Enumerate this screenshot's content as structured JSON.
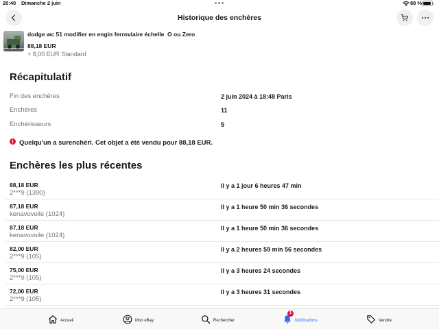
{
  "status_bar": {
    "time": "20:40",
    "date": "Dimanche 2 juin",
    "battery_text": "88 %",
    "battery_level": 0.88
  },
  "header": {
    "title": "Historique des enchères",
    "icons": [
      "chevron-left-icon",
      "cart-icon",
      "more-options-icon"
    ]
  },
  "item": {
    "title": "dodge wc 51 modifier en engin ferroviaire échelle  O ou Zero",
    "price": "88,18 EUR",
    "shipping": "+ 8,00 EUR Standard"
  },
  "summary": {
    "heading": "Récapitulatif",
    "rows": [
      {
        "label": "Fin des enchères",
        "value": "2 juin 2024 à 18:48 Paris"
      },
      {
        "label": "Enchères",
        "value": "11"
      },
      {
        "label": "Enchérisseurs",
        "value": "5"
      }
    ]
  },
  "alert": {
    "icon": "alert-icon",
    "text": "Quelqu'un a surenchéri. Cet objet a été vendu pour 88,18 EUR."
  },
  "recent": {
    "heading": "Enchères les plus récentes",
    "bids": [
      {
        "amount": "88,18 EUR",
        "bidder": "2***9 (1390)",
        "time": "Il y a 1 jour 6 heures 47 min"
      },
      {
        "amount": "87,18 EUR",
        "bidder": "kenavovoile (1024)",
        "time": "Il y a 1 heure 50 min 36 secondes"
      },
      {
        "amount": "87,18 EUR",
        "bidder": "kenavovoile (1024)",
        "time": "Il y a 1 heure 50 min 36 secondes"
      },
      {
        "amount": "82,00 EUR",
        "bidder": "2***9 (105)",
        "time": "Il y a 2 heures 59 min 56 secondes"
      },
      {
        "amount": "75,00 EUR",
        "bidder": "2***9 (105)",
        "time": "Il y a 3 heures 24 secondes"
      },
      {
        "amount": "72,00 EUR",
        "bidder": "2***9 (105)",
        "time": "Il y a 3 heures 31 secondes"
      }
    ]
  },
  "tabbar": {
    "items": [
      {
        "label": "Accueil",
        "icon": "home-icon"
      },
      {
        "label": "Mon eBay",
        "icon": "account-icon"
      },
      {
        "label": "Rechercher",
        "icon": "search-icon"
      },
      {
        "label": "Notifications",
        "icon": "bell-icon",
        "active": true,
        "badge": "1"
      },
      {
        "label": "Vendre",
        "icon": "tag-icon"
      }
    ]
  },
  "colors": {
    "accent": "#3665f3",
    "alert": "#e0103a",
    "text": "#191919",
    "muted": "#707070"
  }
}
